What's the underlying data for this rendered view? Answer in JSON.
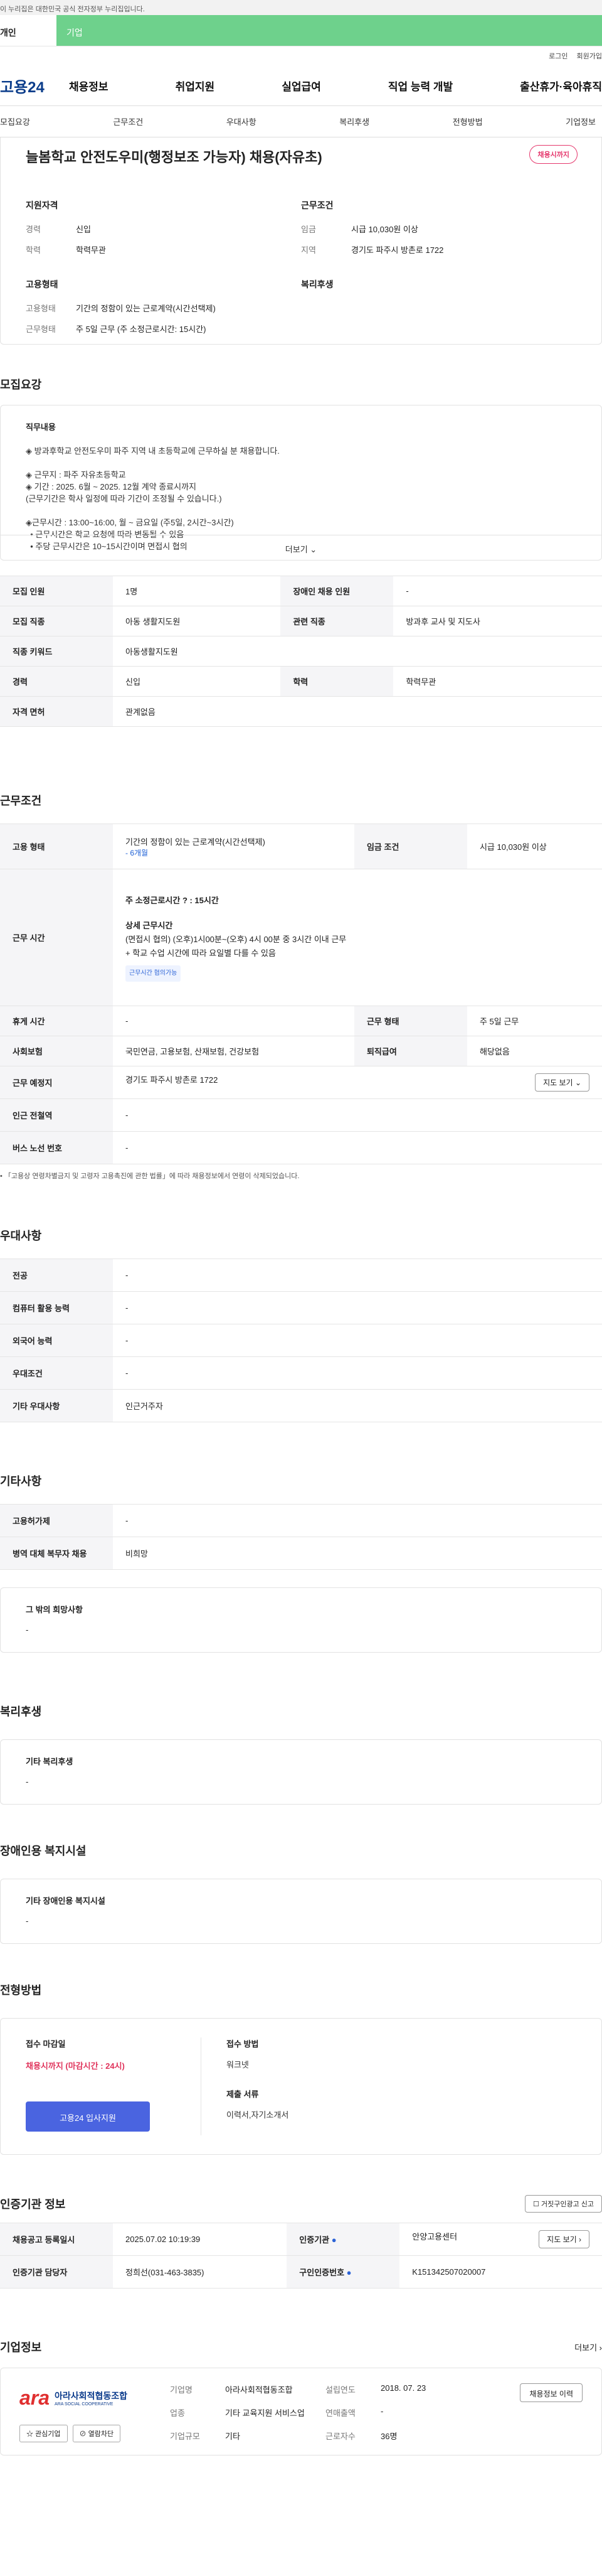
{
  "gov_notice": "이 누리집은 대한민국 공식 전자정부 누리집입니다.",
  "top_tabs": {
    "personal": "개인",
    "company": "기업"
  },
  "util": {
    "login": "로그인",
    "join": "회원가입"
  },
  "logo": "고용24",
  "gnb": [
    "채용정보",
    "취업지원",
    "실업급여",
    "직업 능력 개발",
    "출산휴가·육아휴직"
  ],
  "subnav": [
    "모집요강",
    "근무조건",
    "우대사항",
    "복리후생",
    "전형방법",
    "기업정보"
  ],
  "job": {
    "title": "늘봄학교 안전도우미(행정보조 가능자) 채용(자유초)",
    "deadline_badge": "채용시까지",
    "qual_title": "지원자격",
    "qual": [
      {
        "k": "경력",
        "v": "신입"
      },
      {
        "k": "학력",
        "v": "학력무관"
      }
    ],
    "cond_title": "근무조건",
    "cond": [
      {
        "k": "임금",
        "v": "시급 10,030원 이상"
      },
      {
        "k": "지역",
        "v": "경기도 파주시 방촌로 1722"
      }
    ],
    "emp_title": "고용형태",
    "emp": [
      {
        "k": "고용형태",
        "v": "기간의 정함이 있는 근로계약(시간선택제)"
      },
      {
        "k": "근무형태",
        "v": "주 5일 근무 (주 소정근로시간: 15시간)"
      }
    ],
    "welfare_title": "복리후생"
  },
  "recruit": {
    "heading": "모집요강",
    "label": "직무내용",
    "lines": [
      "◈ 방과후학교 안전도우미 파주 지역 내 초등학교에 근무하실 분 채용합니다.",
      "",
      "◈ 근무지 : 파주 자유초등학교",
      "◈ 기간 : 2025. 6월 ~ 2025. 12월 계약 종료시까지",
      "(근무기간은 학사 일정에 따라 기간이 조정될 수 있습니다.)",
      "",
      "◈근무시간 : 13:00~16:00, 월 ~ 금요일 (주5일, 2시간~3시간)",
      "  • 근무시간은 학교 요청에 따라 변동될 수 있음",
      "  • 주당 근무시간은 10~15시간이며 면접시 협의"
    ],
    "more": "더보기",
    "table": [
      [
        "모집 인원",
        "1명",
        "장애인 채용 인원",
        "-"
      ],
      [
        "모집 직종",
        "아동 생활지도원",
        "관련 직종",
        "방과후 교사 및 지도사"
      ],
      [
        "직종 키워드",
        "아동생활지도원"
      ],
      [
        "경력",
        "신입",
        "학력",
        "학력무관"
      ],
      [
        "자격 면허",
        "관계없음"
      ]
    ]
  },
  "work": {
    "heading": "근무조건",
    "emp_type_k": "고용 형태",
    "emp_type_v": "기간의 정함이 있는 근로계약(시간선택제)",
    "emp_type_sub": "- 6개월",
    "wage_k": "임금 조건",
    "wage_v": "시급 10,030원 이상",
    "hours_k": "근무 시간",
    "hours_main": "주 소정근로시간 ? : 15시간",
    "hours_detail_title": "상세 근무시간",
    "hours_detail1": "(면접시 협의) (오후)1시00분~(오후) 4시 00분 중 3시간 이내 근무",
    "hours_detail2": "+ 학교 수업 시간에 따라 요일별 다를 수 있음",
    "hours_chip": "근무시간 협의가능",
    "rows": [
      [
        "휴게 시간",
        "-",
        "근무 형태",
        "주 5일 근무"
      ],
      [
        "사회보험",
        "국민연금, 고용보험, 산재보험, 건강보험",
        "퇴직급여",
        "해당없음"
      ]
    ],
    "place_k": "근무 예정지",
    "place_v": "경기도 파주시 방촌로 1722",
    "map_btn": "지도 보기",
    "station_k": "인근 전철역",
    "station_v": "-",
    "bus_k": "버스 노선 번호",
    "bus_v": "-",
    "note": "• 「고용상 연령차별금지 및 고령자 고용촉진에 관한 법률」에 따라 채용정보에서 연령이 삭제되었습니다."
  },
  "pref": {
    "heading": "우대사항",
    "rows": [
      [
        "전공",
        "-"
      ],
      [
        "컴퓨터 활용 능력",
        "-"
      ],
      [
        "외국어 능력",
        "-"
      ],
      [
        "우대조건",
        "-"
      ],
      [
        "기타 우대사항",
        "인근거주자"
      ]
    ]
  },
  "etc": {
    "heading": "기타사항",
    "rows": [
      [
        "고용허가제",
        "-"
      ],
      [
        "병역 대체 복무자 채용",
        "비희망"
      ]
    ],
    "other_label": "그 밖의 희망사항",
    "other_value": "-"
  },
  "welfare": {
    "heading": "복리후생",
    "label": "기타 복리후생",
    "value": "-"
  },
  "disabled": {
    "heading": "장애인용 복지시설",
    "label": "기타 장애인용 복지시설",
    "value": "-"
  },
  "process": {
    "heading": "전형방법",
    "deadline_label": "접수 마감일",
    "deadline_value": "채용시까지 (마감시간 : 24시)",
    "apply_btn": "고용24 입사지원",
    "method_label": "접수 방법",
    "method_value": "워크넷",
    "docs_label": "제출 서류",
    "docs_value": "이력서,자기소개서"
  },
  "agency": {
    "heading": "인증기관 정보",
    "report_btn": "거짓구인광고 신고",
    "rows": [
      [
        "채용공고 등록일시",
        "2025.07.02 10:19:39",
        "인증기관",
        "안양고용센터"
      ],
      [
        "인증기관 담당자",
        "정희선(031-463-3835)",
        "구인인증번호",
        "K151342507020007"
      ]
    ],
    "map_btn": "지도 보기"
  },
  "company": {
    "heading": "기업정보",
    "more": "더보기",
    "logo_main": "아라사회적협동조합",
    "logo_sub": "ARA SOCIAL COOPERATIVE",
    "fav_btn": "관심기업",
    "block_btn": "열람차단",
    "info": [
      [
        "기업명",
        "아라사회적협동조합"
      ],
      [
        "설립연도",
        "2018. 07. 23"
      ],
      [
        "업종",
        "기타 교육지원 서비스업"
      ],
      [
        "연매출액",
        "-"
      ],
      [
        "기업규모",
        "기타"
      ],
      [
        "근로자수",
        "36명"
      ]
    ],
    "homepage_btn": "채용정보 이력"
  }
}
